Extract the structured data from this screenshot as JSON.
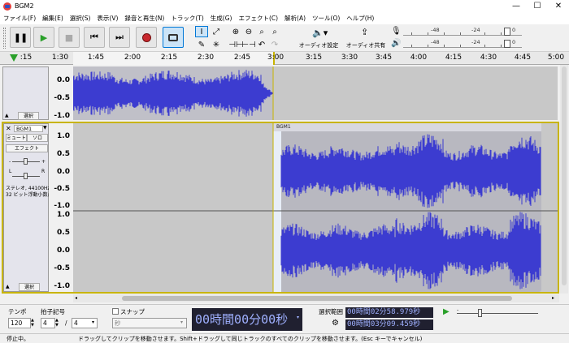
{
  "window": {
    "title": "BGM2",
    "minimize": "—",
    "maximize": "☐",
    "close": "✕"
  },
  "menu": [
    "ファイル(F)",
    "編集(E)",
    "選択(S)",
    "表示(V)",
    "録音と再生(N)",
    "トラック(T)",
    "生成(G)",
    "エフェクト(C)",
    "解析(A)",
    "ツール(O)",
    "ヘルプ(H)"
  ],
  "toolbar": {
    "audio_setup": "オーディオ設定",
    "share_audio": "オーディオ共有",
    "meter_marks": [
      "-48",
      "-24",
      "0"
    ]
  },
  "timeline": {
    "labels": [
      ":15",
      "1:30",
      "1:45",
      "2:00",
      "2:15",
      "2:30",
      "2:45",
      "3:00",
      "3:15",
      "3:30",
      "3:45",
      "4:00",
      "4:15",
      "4:30",
      "4:45",
      "5:00"
    ]
  },
  "track1": {
    "scale": [
      "0.0",
      "-0.5",
      "-1.0"
    ],
    "select_label": "選択"
  },
  "track2": {
    "name": "BGM1",
    "mute": "ミュート",
    "solo": "ソロ",
    "effects": "エフェクト",
    "gain_l": "L",
    "gain_r": "R",
    "info_line1": "ステレオ, 44100Hz",
    "info_line2": "32 ビット浮動小数点",
    "select_label": "選択",
    "clip_name": "BGM1",
    "scale_top": [
      "1.0",
      "0.5",
      "0.0",
      "-0.5",
      "-1.0"
    ],
    "scale_bottom": [
      "1.0",
      "0.5",
      "0.0",
      "-0.5",
      "-1.0"
    ]
  },
  "bottom": {
    "tempo_label": "テンポ",
    "tempo_value": "120",
    "meter_label": "拍子記号",
    "meter_num": "4",
    "meter_sep": "/",
    "meter_den": "4",
    "snap_label": "スナップ",
    "snap_unit": "秒",
    "time_display": "00時間00分00秒",
    "selection_label": "選択範囲",
    "sel_start": "00時間02分58.979秒",
    "sel_end": "00時間03分09.459秒"
  },
  "status": {
    "state": "停止中。",
    "hint": "ドラッグしてクリップを移動させます。Shift+ドラッグして同じトラックのすべてのクリップを移動させます。(Esc キーでキャンセル)"
  },
  "colors": {
    "waveform": "#3c3cd0",
    "waveform_bg": "#c8c8c8",
    "selection": "#ffffff",
    "track_border": "#c8b400"
  }
}
